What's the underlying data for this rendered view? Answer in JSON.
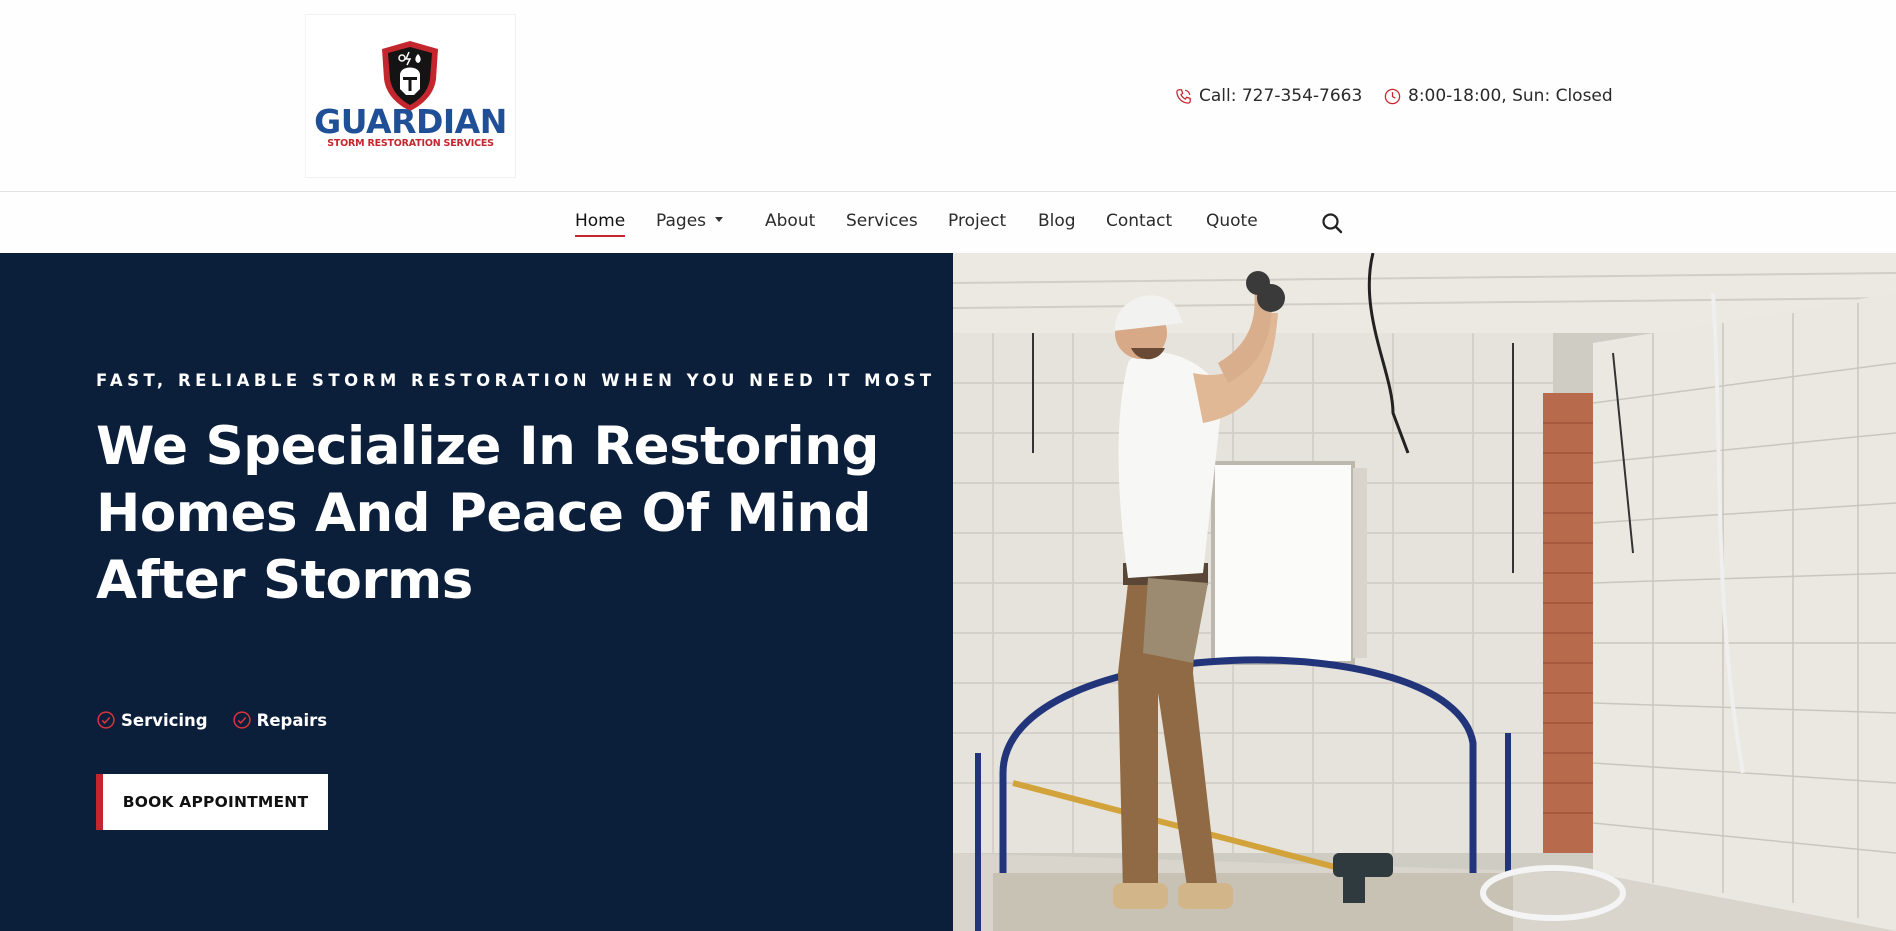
{
  "brand": {
    "name": "GUARDIAN",
    "tagline": "STORM RESTORATION SERVICES",
    "colors": {
      "blue": "#1f4f97",
      "red": "#c4262e",
      "navy": "#0b1e3a"
    }
  },
  "header": {
    "phone": {
      "icon": "phone-icon",
      "text": "Call: 727-354-7663"
    },
    "hours": {
      "icon": "clock-icon",
      "text": "8:00-18:00, Sun: Closed"
    }
  },
  "nav": {
    "items": [
      {
        "label": "Home",
        "active": true
      },
      {
        "label": "Pages",
        "dropdown": true
      },
      {
        "label": "About"
      },
      {
        "label": "Services"
      },
      {
        "label": "Project"
      },
      {
        "label": "Blog"
      },
      {
        "label": "Contact"
      },
      {
        "label": "Quote"
      }
    ],
    "search_icon": "search-icon"
  },
  "hero": {
    "tagline": "FAST, RELIABLE STORM RESTORATION WHEN YOU NEED IT MOST",
    "title": "We Specialize In Restoring Homes And Peace Of Mind After Storms",
    "bullets": [
      "Servicing",
      "Repairs"
    ],
    "bullet_icon": "check-circle-icon",
    "cta": "BOOK APPOINTMENT"
  }
}
